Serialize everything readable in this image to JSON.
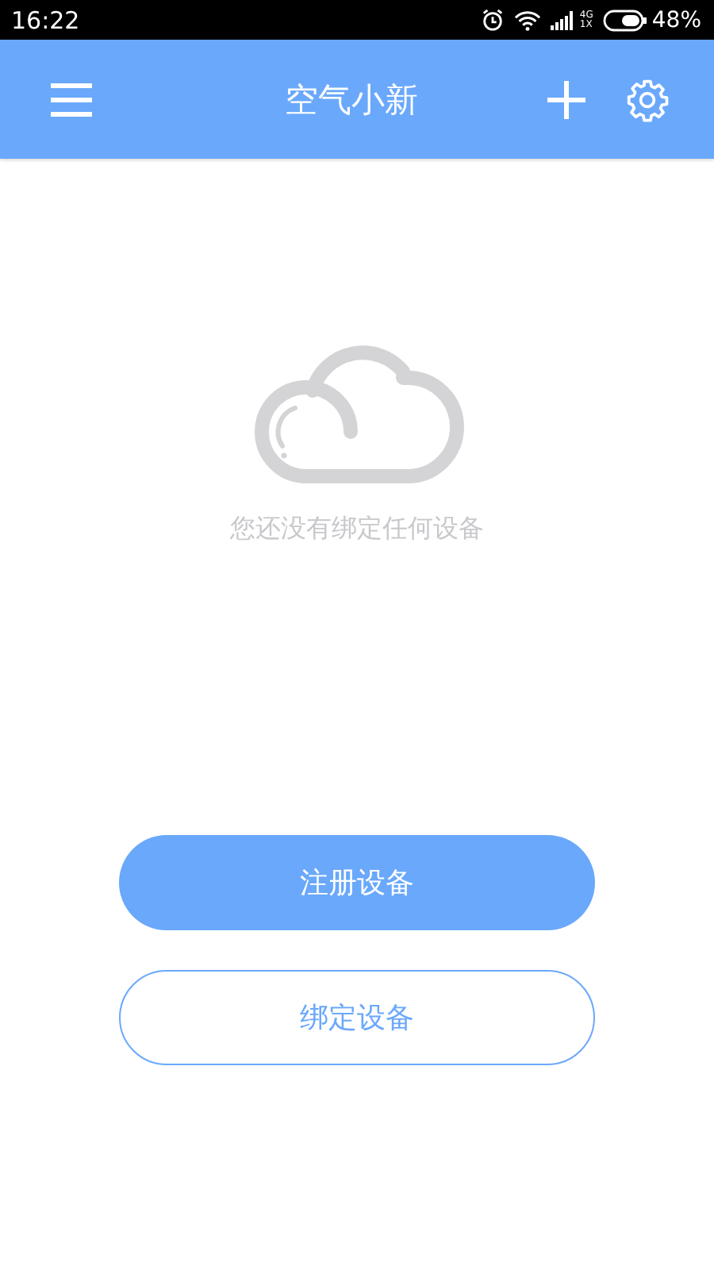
{
  "status_bar": {
    "time": "16:22",
    "network": [
      "4G",
      "1X"
    ],
    "battery": "48%"
  },
  "app_bar": {
    "title": "空气小新"
  },
  "empty_state": {
    "message": "您还没有绑定任何设备"
  },
  "buttons": [
    {
      "label": "注册设备",
      "kind": "filled"
    },
    {
      "label": "绑定设备",
      "kind": "outline"
    }
  ]
}
